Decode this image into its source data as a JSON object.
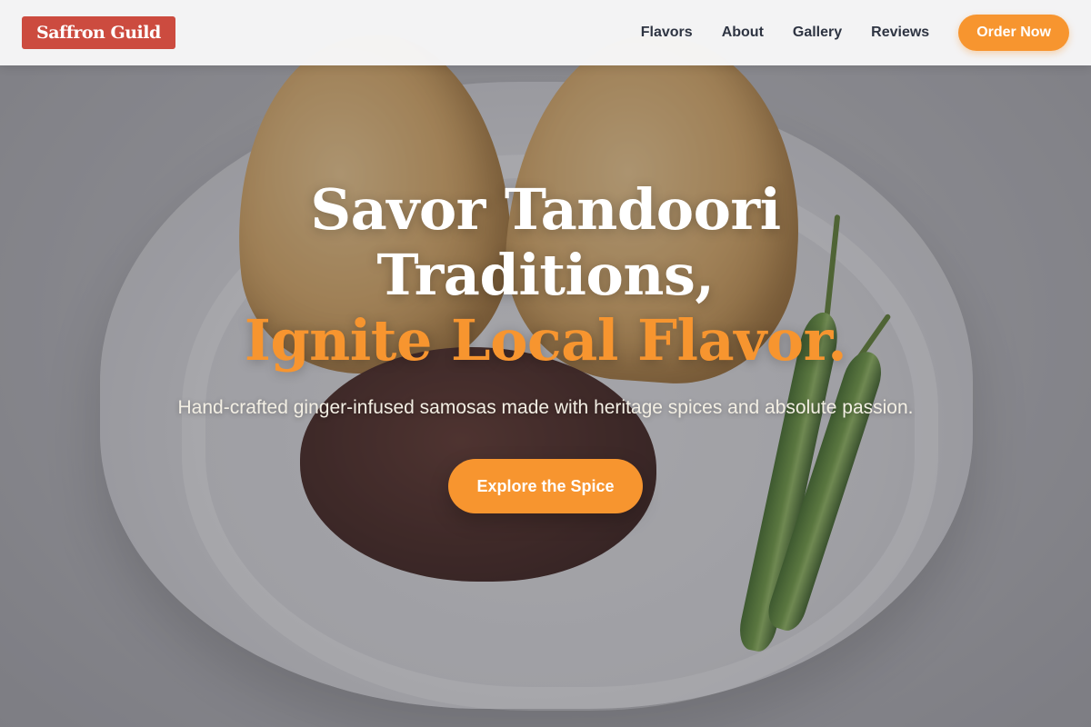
{
  "brand": {
    "logo_text": "Saffron Guild",
    "logo_color": "#cc4b3f"
  },
  "nav": {
    "links": [
      "Flavors",
      "About",
      "Gallery",
      "Reviews"
    ],
    "cta_label": "Order Now"
  },
  "hero": {
    "title_line1": "Savor Tandoori",
    "title_line2": "Traditions,",
    "title_accent": "Ignite Local Flavor.",
    "subtitle": "Hand-crafted ginger-infused samosas made with heritage spices and absolute passion.",
    "cta_label": "Explore the Spice",
    "background_image": "samosas-with-chutney-and-green-chilies"
  },
  "colors": {
    "accent": "#f7952f",
    "nav_text": "#2e3442",
    "nav_background": "#f7f7f8"
  }
}
